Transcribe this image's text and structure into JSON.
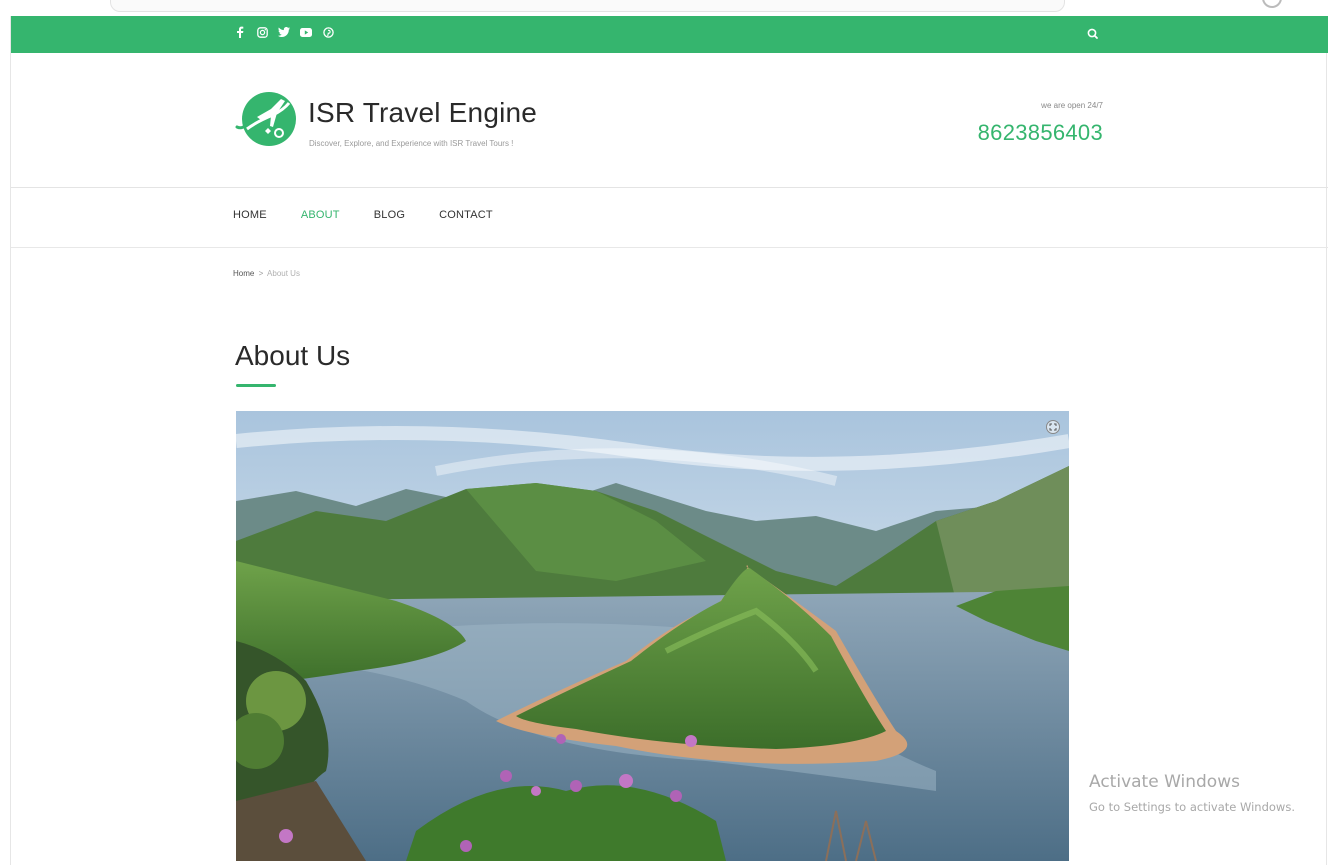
{
  "colors": {
    "accent": "#35b56e",
    "text": "#2a2a2a",
    "muted": "#9a9a9a"
  },
  "topbar": {
    "social_icons": [
      "facebook-icon",
      "instagram-icon",
      "twitter-icon",
      "youtube-icon",
      "pinterest-icon"
    ],
    "search_icon": "search-icon"
  },
  "header": {
    "site_title": "ISR Travel Engine",
    "tagline": "Discover, Explore, and Experience with ISR Travel Tours !",
    "open_text": "we are open 24/7",
    "phone": "8623856403"
  },
  "nav": {
    "items": [
      {
        "label": "HOME",
        "active": false
      },
      {
        "label": "ABOUT",
        "active": true
      },
      {
        "label": "BLOG",
        "active": false
      },
      {
        "label": "CONTACT",
        "active": false
      }
    ]
  },
  "breadcrumb": {
    "home": "Home",
    "separator": ">",
    "current": "About Us"
  },
  "main": {
    "title": "About Us",
    "hero_image": "mountain-river-landscape",
    "hero_expand_icon": "expand-icon"
  },
  "watermark": {
    "line1": "Activate Windows",
    "line2": "Go to Settings to activate Windows."
  }
}
